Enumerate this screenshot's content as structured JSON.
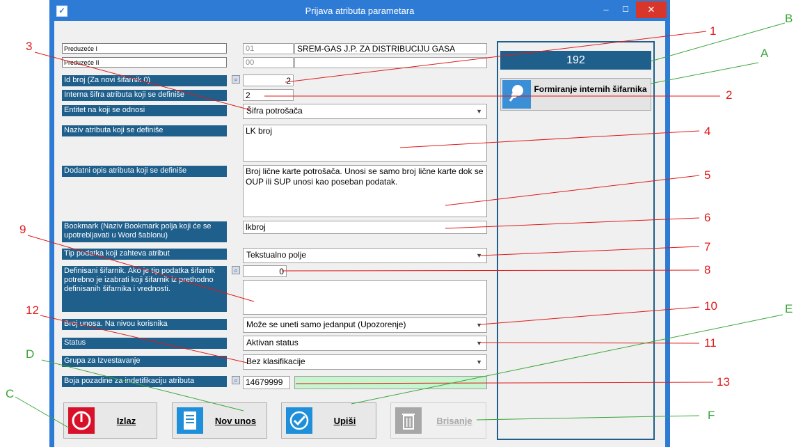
{
  "window": {
    "title": "Prijava atributa parametara",
    "minimize_glyph": "–",
    "maximize_glyph": "☐",
    "close_glyph": "✕"
  },
  "company": {
    "label1": "Preduzeće I",
    "code1": "01",
    "name1": "SREM-GAS J.P. ZA DISTRIBUCIJU GASA",
    "label2": "Preduzeće II",
    "code2": "00",
    "name2": ""
  },
  "form": {
    "id_label": "Id broj (Za novi šifarnik 0)",
    "id_value": "2",
    "internal_code_label": "Interna šifra atributa koji se definiše",
    "internal_code_value": "2",
    "entity_label": "Entitet na koji se odnosi",
    "entity_value": "Šifra potrošača",
    "name_label": "Naziv atributa koji se definiše",
    "name_value": "LK broj",
    "desc_label": "Dodatni opis atributa koji se definiše",
    "desc_value": "Broj lične karte potrošača. Unosi se samo broj lične karte dok se OUP ili SUP unosi kao poseban podatak.",
    "bookmark_label": "Bookmark (Naziv Bookmark polja koji će se upotrebljavati u Word šablonu)",
    "bookmark_value": "lkbroj",
    "type_label": "Tip podatka koji zahteva atribut",
    "type_value": "Tekstualno polje",
    "codebook_label": "Definisani šifarnik. Ako je tip podatka šifarnik potrebno je izabrati koji šifarnik iz prethodno definisanih šifarnika i vrednosti.",
    "codebook_id": "0",
    "codebook_value": "",
    "entries_label": "Broj unosa. Na nivou korisnika",
    "entries_value": "Može se uneti samo jedanput (Upozorenje)",
    "status_label": "Status",
    "status_value": "Aktivan status",
    "group_label": "Grupa za Izvestavanje",
    "group_value": "Bez klasifikacije",
    "color_label": "Boja pozadine za indetifikaciju atributa",
    "color_value": "14679999",
    "color_swatch": "#c7f5cf"
  },
  "panel": {
    "counter": "192",
    "form_button": "Formiranje internih šifarnika"
  },
  "buttons": {
    "exit": "Izlaz",
    "new": "Nov unos",
    "save": "Upiši",
    "delete": "Brisanje"
  },
  "annotations": {
    "n1": "1",
    "n2": "2",
    "n3": "3",
    "n4": "4",
    "n5": "5",
    "n6": "6",
    "n7": "7",
    "n8": "8",
    "n9": "9",
    "n10": "10",
    "n11": "11",
    "n12": "12",
    "n13": "13",
    "A": "A",
    "B": "B",
    "C": "C",
    "D": "D",
    "E": "E",
    "F": "F"
  },
  "colors": {
    "title_bar": "#2e7bd6",
    "label_bg": "#1f5f8b",
    "annotation_red": "#e01a1a",
    "annotation_green": "#3aa53a",
    "close_button": "#d9362b"
  },
  "icons": [
    "checkbox-app-icon",
    "search-lens-icon",
    "pushpin-icon",
    "power-icon",
    "document-icon",
    "checkmark-icon",
    "trash-icon"
  ]
}
